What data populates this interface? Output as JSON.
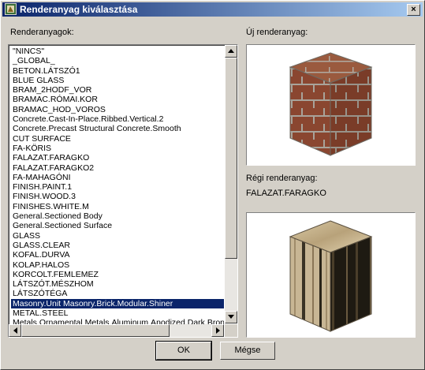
{
  "window": {
    "title": "Renderanyag kiválasztása",
    "close_label": "×"
  },
  "left": {
    "label": "Renderanyagok:",
    "selected_index": 26,
    "items": [
      "\"NINCS\"",
      "_GLOBAL_",
      "BETON.LÁTSZÓ1",
      "BLUE GLASS",
      "BRAM_2HODF_VOR",
      "BRAMAC.RÓMAI.KOR",
      "BRAMAC_HOD_VOROS",
      "Concrete.Cast-In-Place.Ribbed.Vertical.2",
      "Concrete.Precast Structural Concrete.Smooth",
      "CUT SURFACE",
      "FA-KÖRIS",
      "FALAZAT.FARAGKO",
      "FALAZAT.FARAGKO2",
      "FA-MAHAGÓNI",
      "FINISH.PAINT.1",
      "FINISH.WOOD.3",
      "FINISHES.WHITE.M",
      "General.Sectioned Body",
      "General.Sectioned Surface",
      "GLASS",
      "GLASS.CLEAR",
      "KOFAL.DURVA",
      "KOLAP.HALOS",
      "KORCOLT.FEMLEMEZ",
      "LÁTSZÓT.MÉSZHOM",
      "LÁTSZÓTÉGA",
      "Masonry.Unit Masonry.Brick.Modular.Shiner",
      "METAL.STEEL",
      "Metals.Ornamental Metals.Aluminum.Anodized.Dark.Bronze"
    ]
  },
  "right": {
    "new_label": "Új renderanyag:",
    "old_label": "Régi renderanyag:",
    "old_value": "FALAZAT.FARAGKO"
  },
  "buttons": {
    "ok": "OK",
    "cancel": "Mégse"
  },
  "icons": {
    "app": "app-icon",
    "close": "close-icon",
    "up": "scroll-up-icon",
    "down": "scroll-down-icon",
    "left": "scroll-left-icon",
    "right": "scroll-right-icon"
  },
  "colors": {
    "title_start": "#0a246a",
    "title_end": "#a6caf0",
    "selection": "#0a246a",
    "face": "#d4d0c8"
  }
}
